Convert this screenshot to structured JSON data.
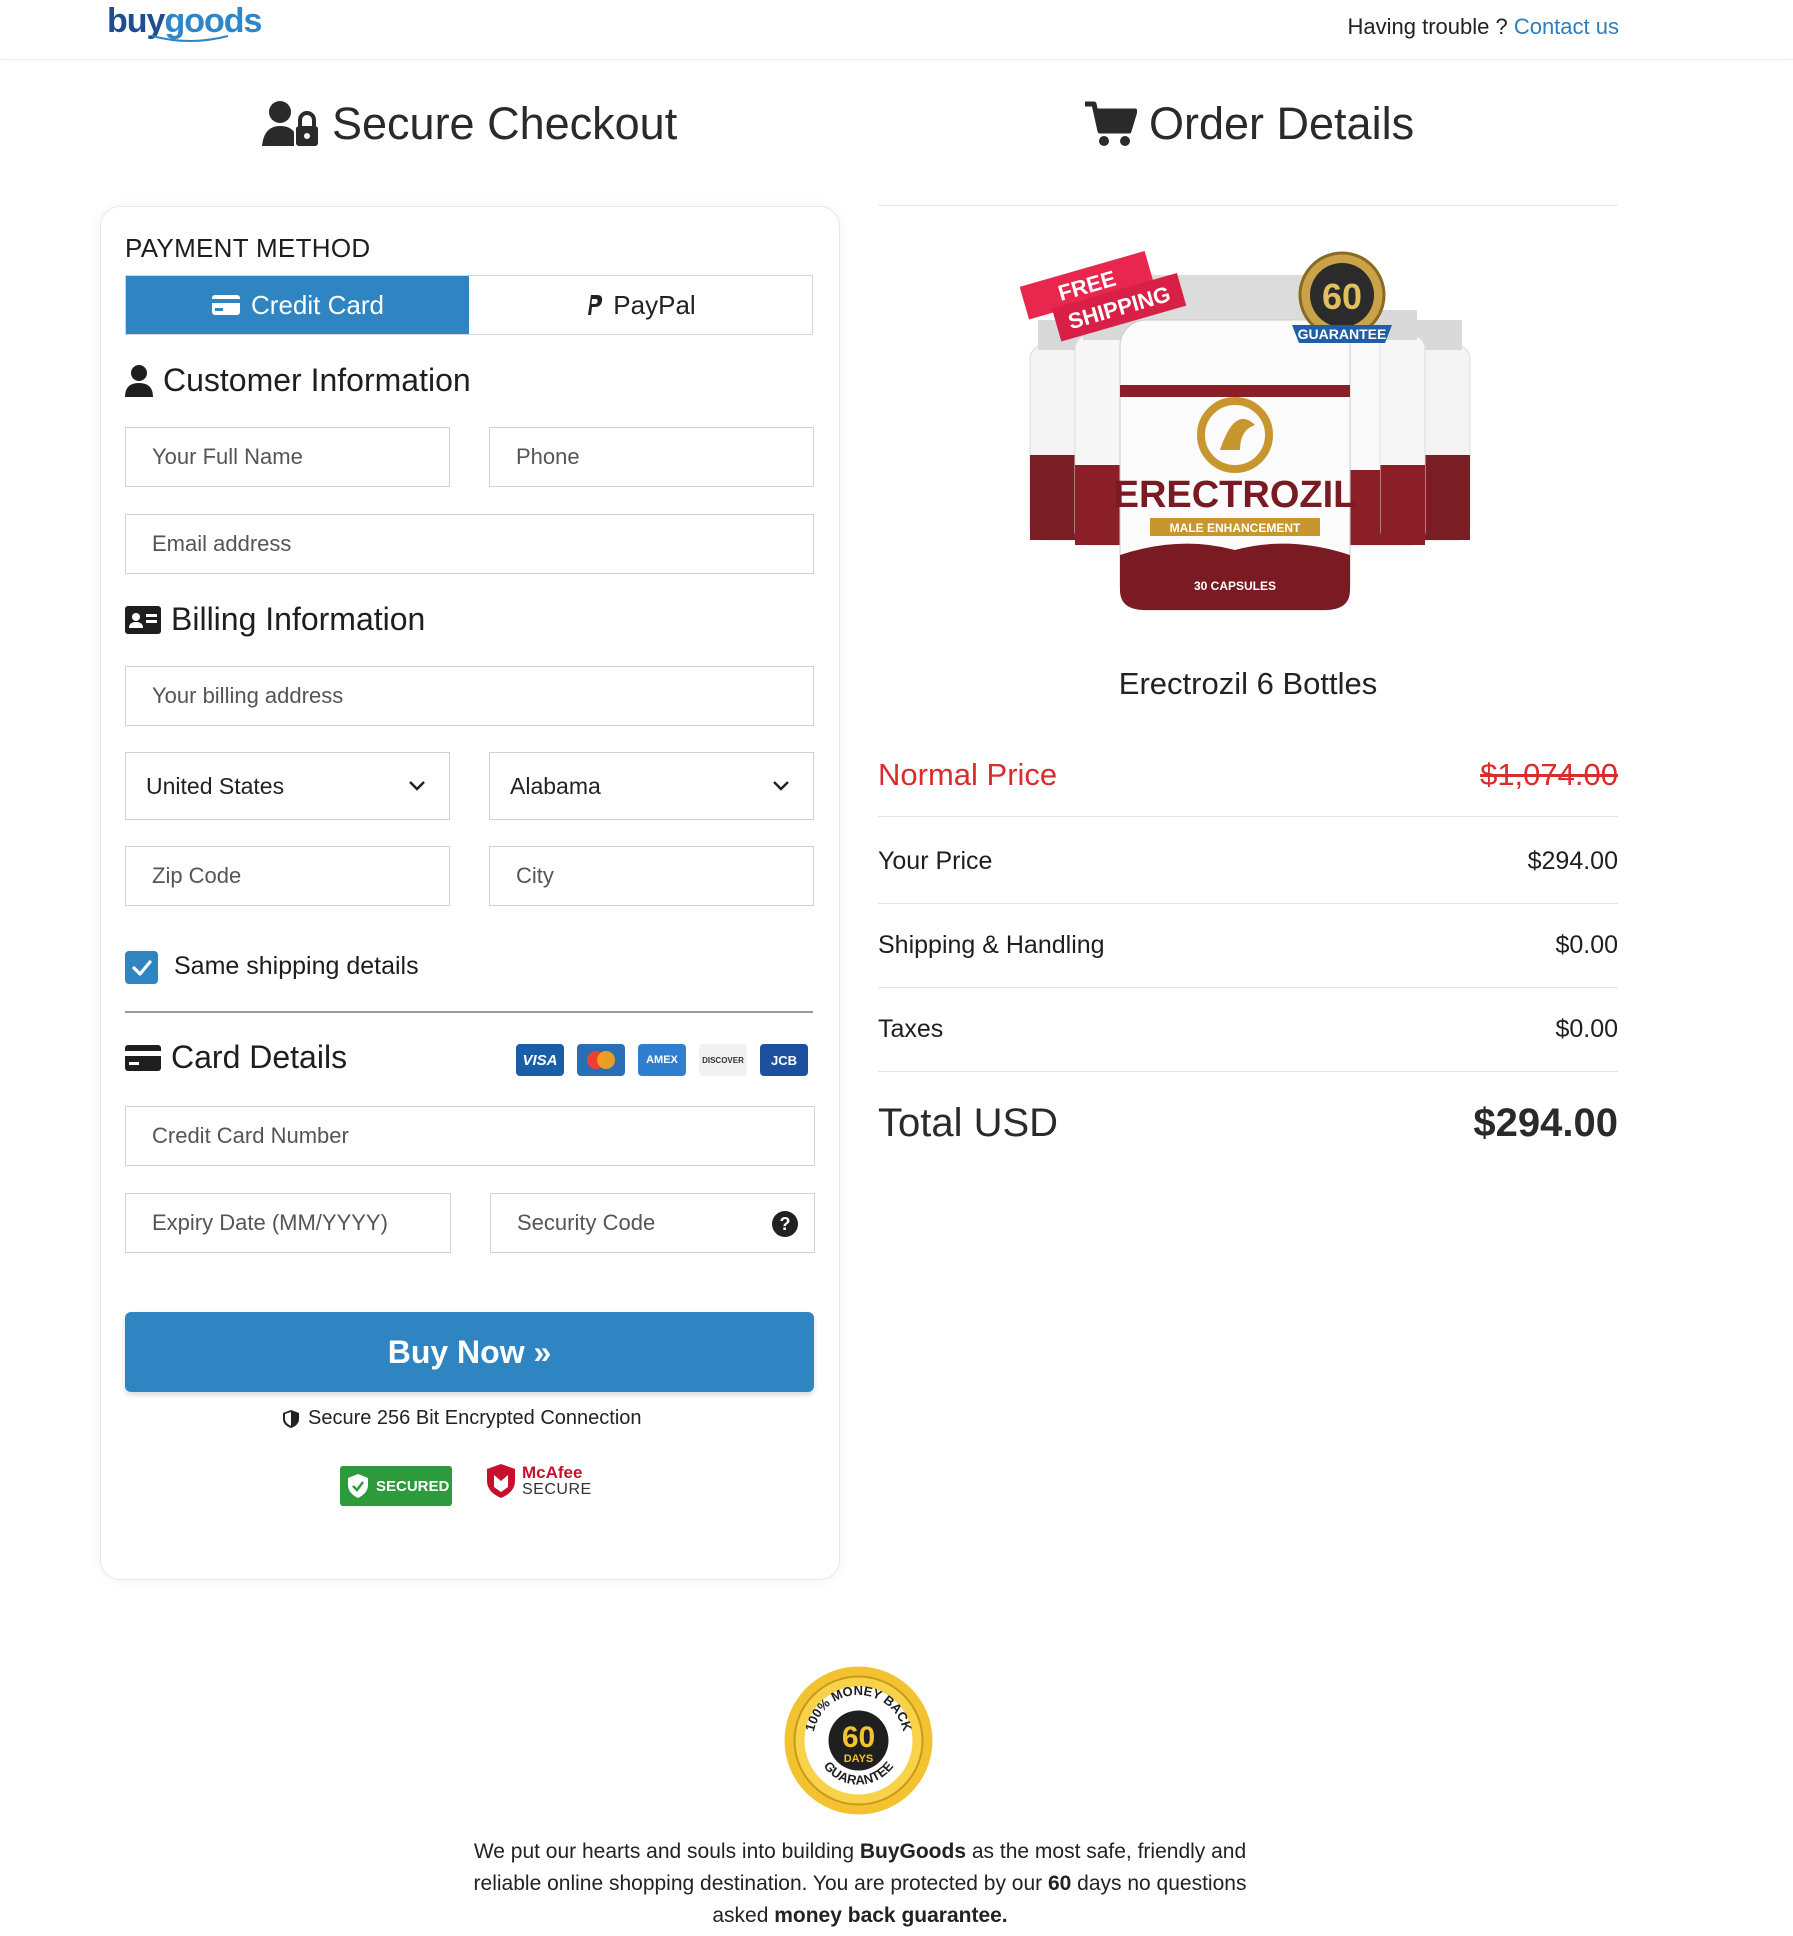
{
  "header": {
    "logo_part1": "buy",
    "logo_part2": "goods",
    "help_text": "Having trouble ?",
    "contact_link": "Contact us"
  },
  "checkout": {
    "title": "Secure Checkout",
    "payment_method_label": "PAYMENT METHOD",
    "tabs": [
      {
        "label": "Credit Card",
        "active": true
      },
      {
        "label": "PayPal",
        "active": false
      }
    ],
    "customer_info_title": "Customer Information",
    "full_name_placeholder": "Your Full Name",
    "phone_placeholder": "Phone",
    "email_placeholder": "Email address",
    "billing_info_title": "Billing Information",
    "billing_address_placeholder": "Your billing address",
    "country_value": "United States",
    "state_value": "Alabama",
    "zip_placeholder": "Zip Code",
    "city_placeholder": "City",
    "same_shipping_label": "Same shipping details",
    "same_shipping_checked": true,
    "card_details_title": "Card Details",
    "card_logos": [
      "VISA",
      "mastercard",
      "AMEX",
      "DISCOVER",
      "JCB"
    ],
    "card_number_placeholder": "Credit Card Number",
    "expiry_placeholder": "Expiry Date (MM/YYYY)",
    "security_code_placeholder": "Security Code",
    "buy_button": "Buy Now »",
    "secure_text": "Secure 256 Bit Encrypted Connection",
    "badge_secured": "SECURED",
    "badge_mcafee_1": "McAfee",
    "badge_mcafee_2": "SECURE"
  },
  "order": {
    "title": "Order Details",
    "product_name": "Erectrozil 6 Bottles",
    "product_image_text": "ERECTROZIL",
    "product_image_subtext": "MALE ENHANCEMENT",
    "product_image_capsules": "30 CAPSULES",
    "ribbon_text_1": "FREE",
    "ribbon_text_2": "SHIPPING",
    "guarantee_number": "60",
    "guarantee_label": "GUARANTEE",
    "rows": [
      {
        "label": "Normal Price",
        "value": "$1,074.00"
      },
      {
        "label": "Your Price",
        "value": "$294.00"
      },
      {
        "label": "Shipping & Handling",
        "value": "$0.00"
      },
      {
        "label": "Taxes",
        "value": "$0.00"
      }
    ],
    "total_label": "Total USD",
    "total_value": "$294.00"
  },
  "footer": {
    "seal_top": "100% MONEY BACK",
    "seal_number": "60",
    "seal_days": "DAYS",
    "seal_bottom": "GUARANTEE",
    "text_1": "We put our hearts and souls into building ",
    "text_brand": "BuyGoods",
    "text_2": " as the most safe, friendly and reliable online shopping destination. You are protected by our ",
    "text_60": "60",
    "text_3": " days no questions asked ",
    "text_mbg": "money back guarantee."
  },
  "colors": {
    "primary": "#2f85c1",
    "danger": "#d92c2c",
    "link": "#2e7dbd"
  }
}
